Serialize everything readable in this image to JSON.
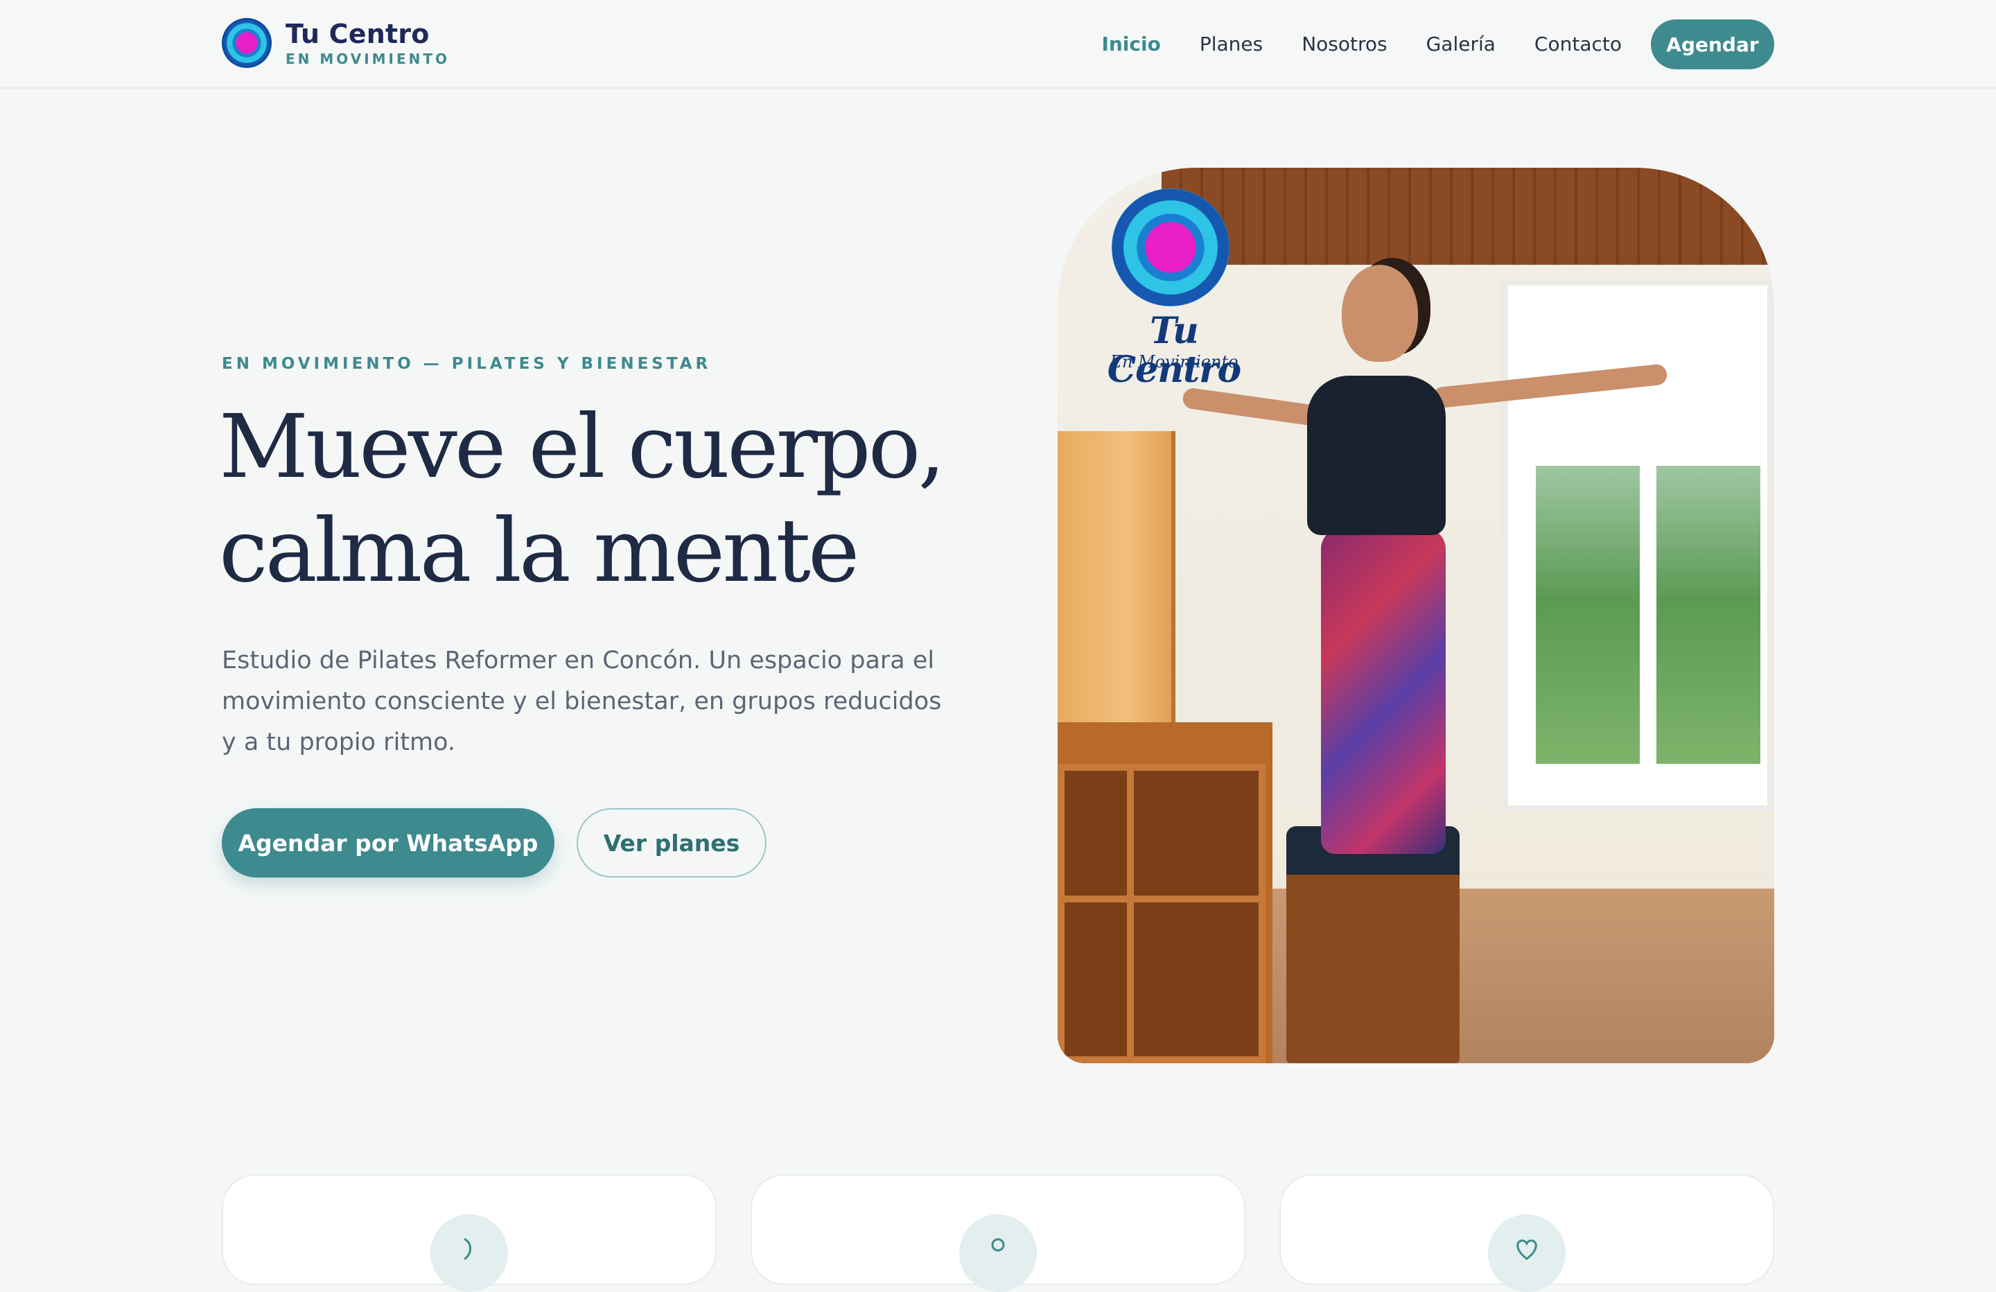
{
  "brand": {
    "name": "Tu Centro",
    "tagline": "EN MOVIMIENTO"
  },
  "nav": {
    "links": [
      "Inicio",
      "Planes",
      "Nosotros",
      "Galería",
      "Contacto"
    ],
    "active": "Inicio",
    "cta": "Agendar"
  },
  "hero": {
    "eyebrow": "EN MOVIMIENTO — PILATES Y BIENESTAR",
    "headline_line1": "Mueve el cuerpo,",
    "headline_line2": "calma la mente",
    "subcopy": "Estudio de Pilates Reformer en Concón. Un espacio para el movimiento consciente y el bienestar, en grupos reducidos y a tu propio ritmo.",
    "primary_button": "Agendar por WhatsApp",
    "secondary_button": "Ver planes"
  },
  "photo": {
    "logo_name": "Tu Centro",
    "logo_sub": "En Movimiento"
  },
  "feature_cards": [
    {
      "icon": "leaf-icon"
    },
    {
      "icon": "person-icon"
    },
    {
      "icon": "heart-icon"
    }
  ],
  "colors": {
    "accent": "#3d8a8f",
    "heading": "#1f2a44",
    "body_text": "#5c6573",
    "background": "#f5f7f7"
  }
}
